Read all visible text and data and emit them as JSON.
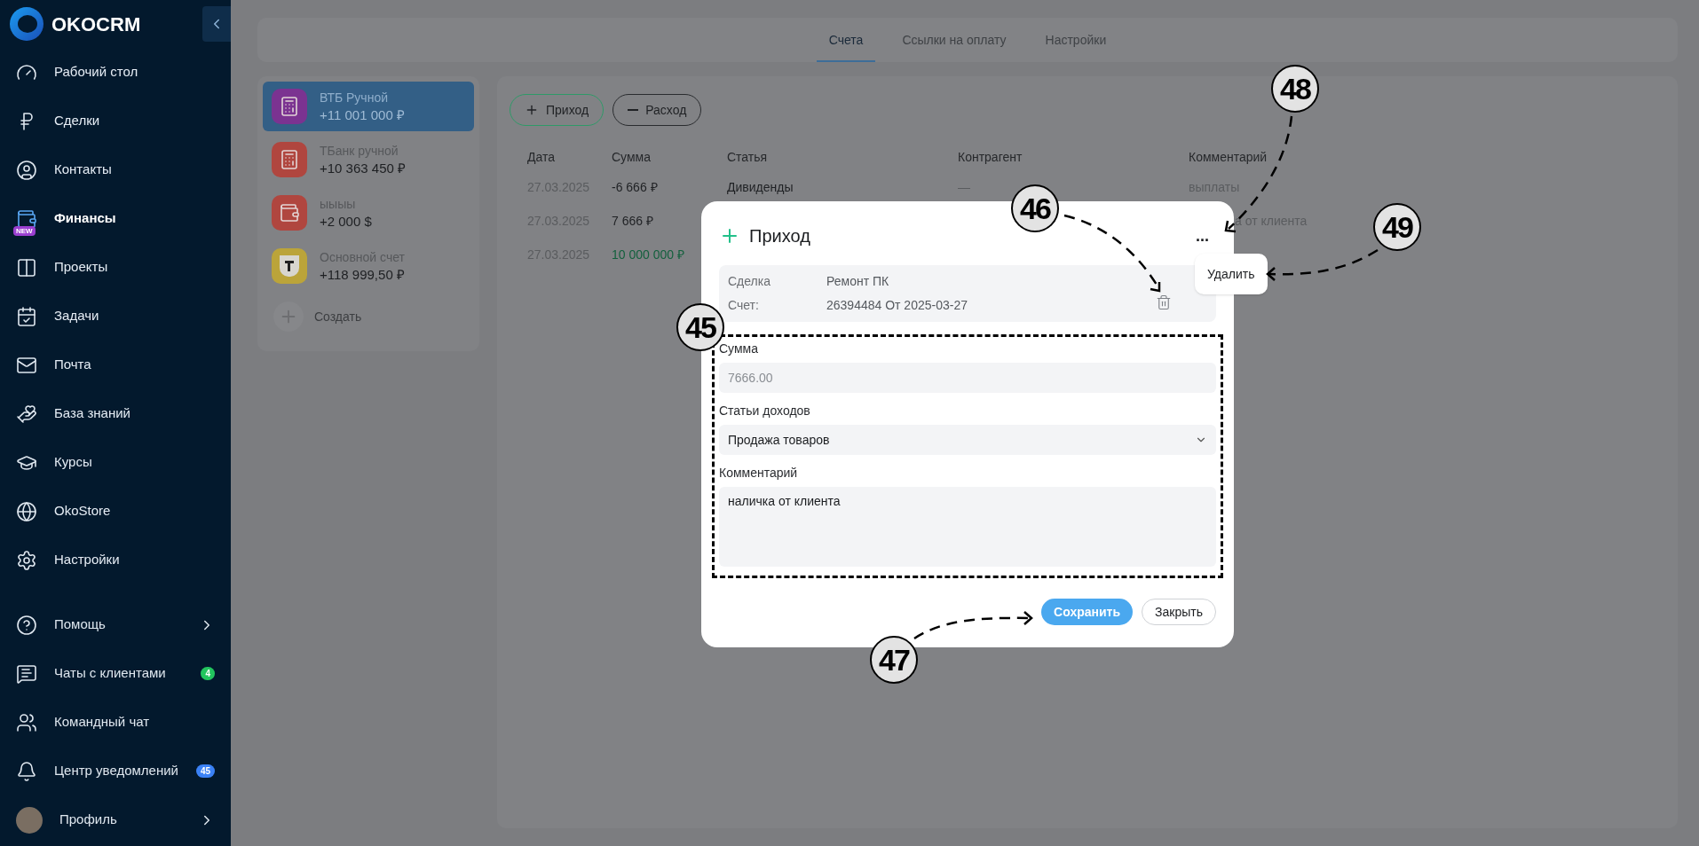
{
  "sidebar": {
    "logo": "OKOCRM",
    "items": [
      {
        "label": "Рабочий стол",
        "selected": false
      },
      {
        "label": "Сделки",
        "selected": false
      },
      {
        "label": "Контакты",
        "selected": false
      },
      {
        "label": "Финансы",
        "selected": true,
        "badge": "NEW"
      },
      {
        "label": "Проекты",
        "selected": false
      },
      {
        "label": "Задачи",
        "selected": false
      },
      {
        "label": "Почта",
        "selected": false
      },
      {
        "label": "База знаний",
        "selected": false
      },
      {
        "label": "Курсы",
        "selected": false
      },
      {
        "label": "OkoStore",
        "selected": false
      },
      {
        "label": "Настройки",
        "selected": false
      }
    ],
    "bottom_items": [
      {
        "label": "Помощь",
        "submenu": true
      },
      {
        "label": "Чаты с клиентами",
        "submenu": false,
        "count": "4",
        "color": "#22c55e"
      },
      {
        "label": "Командный чат",
        "submenu": false
      },
      {
        "label": "Центр уведомлений",
        "submenu": false,
        "count": "45",
        "color": "#3b82f6"
      },
      {
        "label": "Профиль",
        "submenu": true,
        "kind": "profile"
      }
    ]
  },
  "tabs": [
    {
      "label": "Счета",
      "selected": true
    },
    {
      "label": "Ссылки на оплату",
      "selected": false
    },
    {
      "label": "Настройки",
      "selected": false
    }
  ],
  "accounts": [
    {
      "name": "ВТБ Ручной",
      "balance": "+11 001 000 ₽",
      "color": "#7b3391",
      "selected": true
    },
    {
      "name": "ТБанк ручной",
      "balance": "+10 363 450 ₽",
      "color": "#b0463f",
      "selected": false
    },
    {
      "name": "ыыыы",
      "balance": "+2 000 $",
      "color": "#b0463f",
      "selected": false
    },
    {
      "name": "Основной счет",
      "balance": "+118 999,50 ₽",
      "color": "#bba43a",
      "selected": false
    }
  ],
  "create_account": "Создать",
  "actions": [
    {
      "label": "Приход",
      "kind": "income"
    },
    {
      "label": "Расход",
      "kind": "expense"
    }
  ],
  "table": {
    "columns": [
      "Дата",
      "Сумма",
      "Статья",
      "Контрагент",
      "Комментарий"
    ],
    "rows": [
      {
        "date": "27.03.2025",
        "amount": "-6 666 ₽",
        "highlighted": false,
        "article": "Дивиденды",
        "counterparty": "—",
        "comment": "выплаты",
        "comment_cut": false
      },
      {
        "date": "27.03.2025",
        "amount": "7 666 ₽",
        "highlighted": false,
        "comment": "а от клиента",
        "comment_cut": true
      },
      {
        "date": "27.03.2025",
        "amount": "10 000 000 ₽",
        "highlighted": true
      }
    ]
  },
  "modal": {
    "title": "Приход",
    "info": [
      {
        "label": "Сделка",
        "value": "Ремонт ПК"
      },
      {
        "label": "Счет:",
        "value": "26394484 От 2025-03-27"
      }
    ],
    "fields": [
      {
        "kind": "input",
        "label": "Сумма",
        "value": "7666.00",
        "disabled": true
      },
      {
        "kind": "select",
        "label": "Статьи доходов",
        "value": "Продажа товаров"
      },
      {
        "kind": "textarea",
        "label": "Комментарий",
        "value": "наличка от клиента"
      }
    ],
    "menu_button": "...",
    "menu": [
      {
        "label": "Удалить"
      }
    ],
    "buttons": [
      {
        "label": "Сохранить",
        "kind": "primary"
      },
      {
        "label": "Закрыть",
        "kind": "secondary"
      }
    ]
  },
  "callouts": [
    {
      "label": "45"
    },
    {
      "label": "46"
    },
    {
      "label": "47"
    },
    {
      "label": "48"
    },
    {
      "label": "49"
    }
  ]
}
